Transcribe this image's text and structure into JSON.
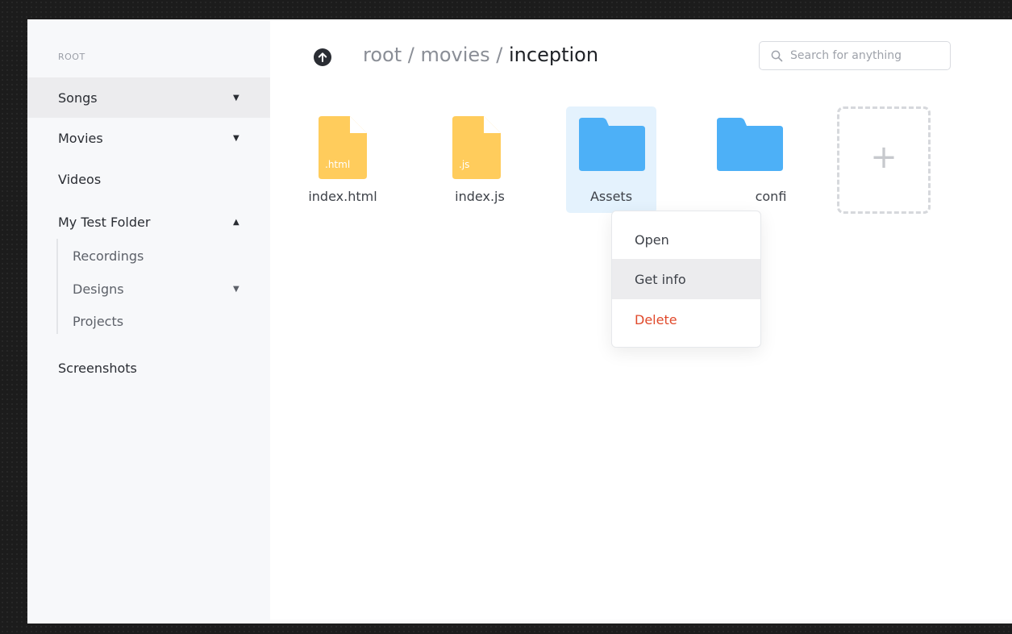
{
  "sidebar": {
    "root_label": "ROOT",
    "items": [
      {
        "label": "Songs",
        "caret": "▼"
      },
      {
        "label": "Movies",
        "caret": "▼"
      },
      {
        "label": "Videos",
        "caret": ""
      },
      {
        "label": "My Test Folder",
        "caret": "▲"
      }
    ],
    "subitems": [
      {
        "label": "Recordings",
        "caret": ""
      },
      {
        "label": "Designs",
        "caret": "▼"
      },
      {
        "label": "Projects",
        "caret": ""
      }
    ],
    "last_item": {
      "label": "Screenshots"
    }
  },
  "header": {
    "breadcrumb_prefix": "root / movies / ",
    "breadcrumb_current": "inception",
    "search_placeholder": "Search for anything"
  },
  "files": [
    {
      "name": "index.html",
      "type": "file",
      "ext": ".html",
      "icon": "file-icon"
    },
    {
      "name": "index.js",
      "type": "file",
      "ext": ".js",
      "icon": "file-icon"
    },
    {
      "name": "Assets",
      "type": "folder",
      "icon": "folder-icon",
      "selected": true
    },
    {
      "name": "confi",
      "type": "folder",
      "icon": "folder-icon"
    }
  ],
  "add_tile": {
    "icon": "plus-icon",
    "glyph": "+"
  },
  "context_menu": {
    "items": [
      "Open",
      "Get info",
      "Delete"
    ]
  },
  "colors": {
    "file_yellow": "#ffcc5c",
    "folder_blue": "#4db0f7",
    "selection_bg": "#e4f2fd",
    "danger": "#e0492b",
    "active_bg": "#ececee"
  }
}
